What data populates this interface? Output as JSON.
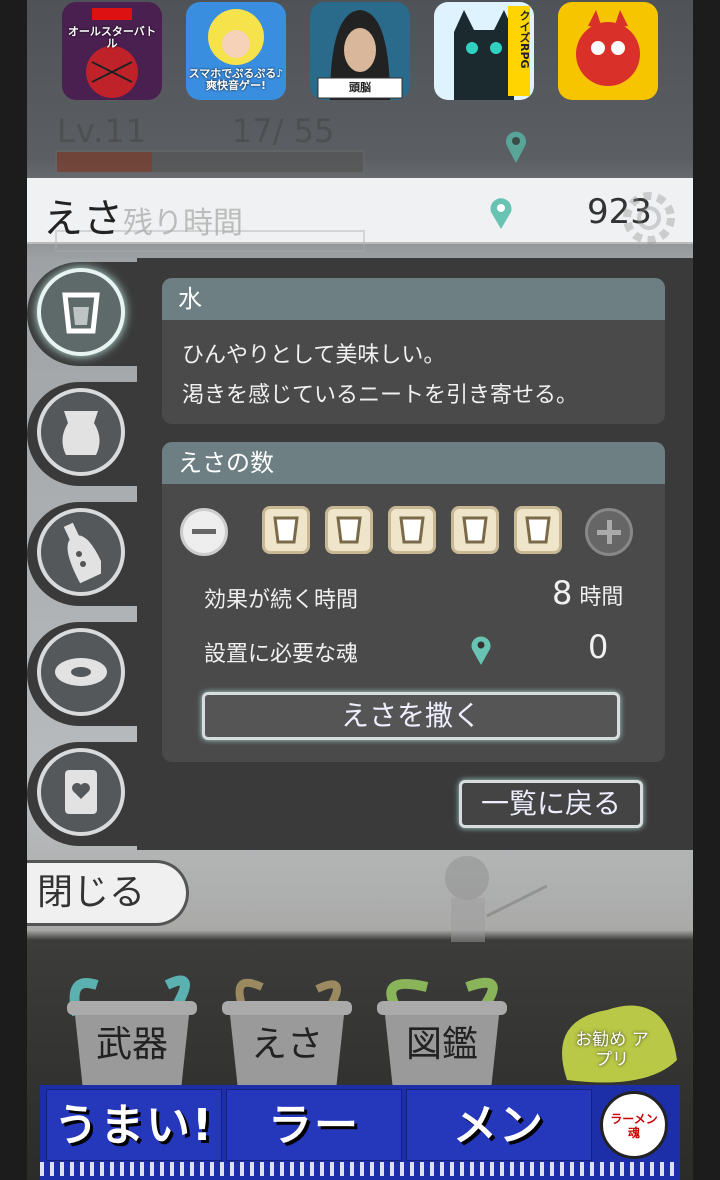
{
  "app_ads": [
    {
      "name": "app-ad-marvel",
      "label": "オールスターバトル",
      "bg": "#4a2050"
    },
    {
      "name": "app-ad-music",
      "label": "スマホでぷるぷる♪ 爽快音ゲー!",
      "bg": "#3a8ee0"
    },
    {
      "name": "app-ad-brain",
      "label": "頭脳",
      "bg": "#2a6a8a"
    },
    {
      "name": "app-ad-quiz",
      "label": "クイズRPG",
      "bg": "#dff3ff"
    },
    {
      "name": "app-ad-monster",
      "label": "",
      "bg": "#f7c400"
    }
  ],
  "status": {
    "level": "Lv.11",
    "exp": "17/   55",
    "exp_fill_fraction": 0.31,
    "timer_label": "残り時間"
  },
  "header": {
    "title": "えさ",
    "soul_count": "923"
  },
  "tabs": [
    {
      "name": "tab-water",
      "icon": "cup-icon",
      "active": true
    },
    {
      "name": "tab-bag",
      "icon": "bag-icon",
      "active": false
    },
    {
      "name": "tab-bottle",
      "icon": "bottle-icon",
      "active": false
    },
    {
      "name": "tab-disc",
      "icon": "disc-icon",
      "active": false
    },
    {
      "name": "tab-card",
      "icon": "card-icon",
      "active": false
    }
  ],
  "item": {
    "name": "水",
    "desc_line1": "ひんやりとして美味しい。",
    "desc_line2": "渇きを感じているニートを引き寄せる。"
  },
  "quantity": {
    "heading": "えさの数",
    "count": 5,
    "effect_label": "効果が続く時間",
    "effect_value": "8",
    "effect_unit": "時間",
    "soul_label": "設置に必要な魂",
    "soul_value": "0",
    "scatter_button": "えさを撒く"
  },
  "back_button": "一覧に戻る",
  "close_button": "閉じる",
  "bottom_nav": {
    "weapons": "武器",
    "bait": "えさ",
    "encyclopedia": "図鑑",
    "recommended": "お勧め アプリ"
  },
  "banner": {
    "segments": [
      "うまい!",
      "ラー",
      "メン"
    ],
    "logo_text": "ラーメン 魂"
  }
}
